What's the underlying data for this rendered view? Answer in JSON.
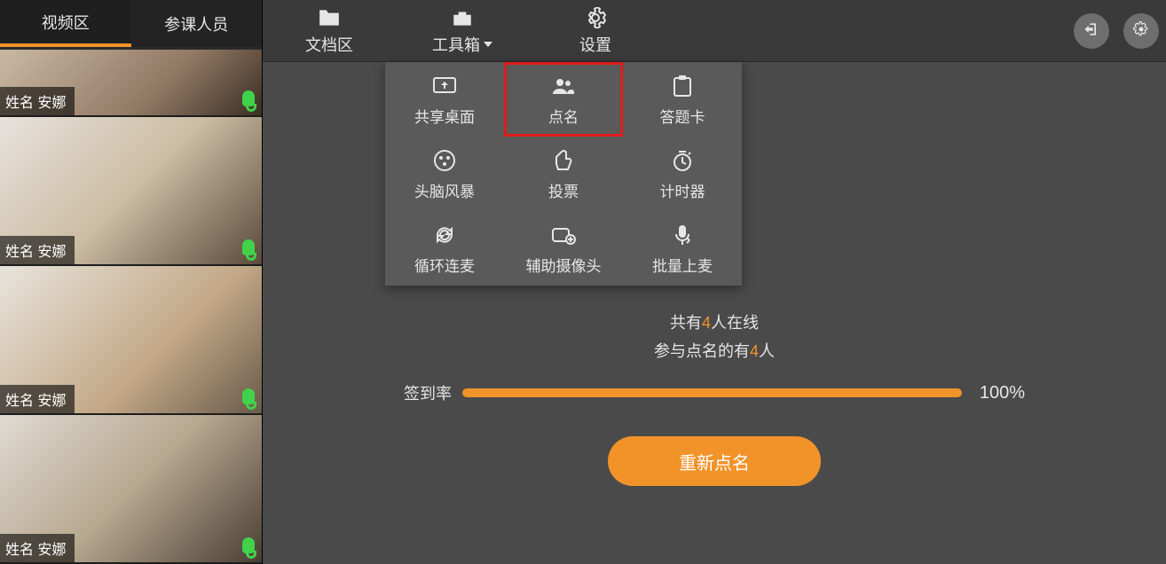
{
  "left": {
    "tabs": [
      {
        "label": "视频区",
        "active": true
      },
      {
        "label": "参课人员",
        "active": false
      }
    ],
    "videos": [
      {
        "name": "姓名 安娜"
      },
      {
        "name": "姓名 安娜"
      },
      {
        "name": "姓名 安娜"
      },
      {
        "name": "姓名 安娜"
      }
    ]
  },
  "toolbar": {
    "doc_label": "文档区",
    "tools_label": "工具箱",
    "settings_label": "设置"
  },
  "tools_panel": {
    "items": [
      {
        "label": "共享桌面",
        "icon": "share-screen-icon"
      },
      {
        "label": "点名",
        "icon": "roll-call-icon",
        "highlight": true
      },
      {
        "label": "答题卡",
        "icon": "answer-card-icon"
      },
      {
        "label": "头脑风暴",
        "icon": "brainstorm-icon"
      },
      {
        "label": "投票",
        "icon": "vote-icon"
      },
      {
        "label": "计时器",
        "icon": "timer-icon"
      },
      {
        "label": "循环连麦",
        "icon": "rotate-mic-icon"
      },
      {
        "label": "辅助摄像头",
        "icon": "aux-camera-icon"
      },
      {
        "label": "批量上麦",
        "icon": "batch-mic-icon"
      }
    ]
  },
  "rollcall": {
    "line1_prefix": "共有",
    "line1_count": "4",
    "line1_suffix": "人在线",
    "line2_prefix": "参与点名的有",
    "line2_count": "4",
    "line2_suffix": "人",
    "progress_label": "签到率",
    "progress_pct_text": "100%",
    "progress_pct_value": 100,
    "retry_label": "重新点名"
  }
}
